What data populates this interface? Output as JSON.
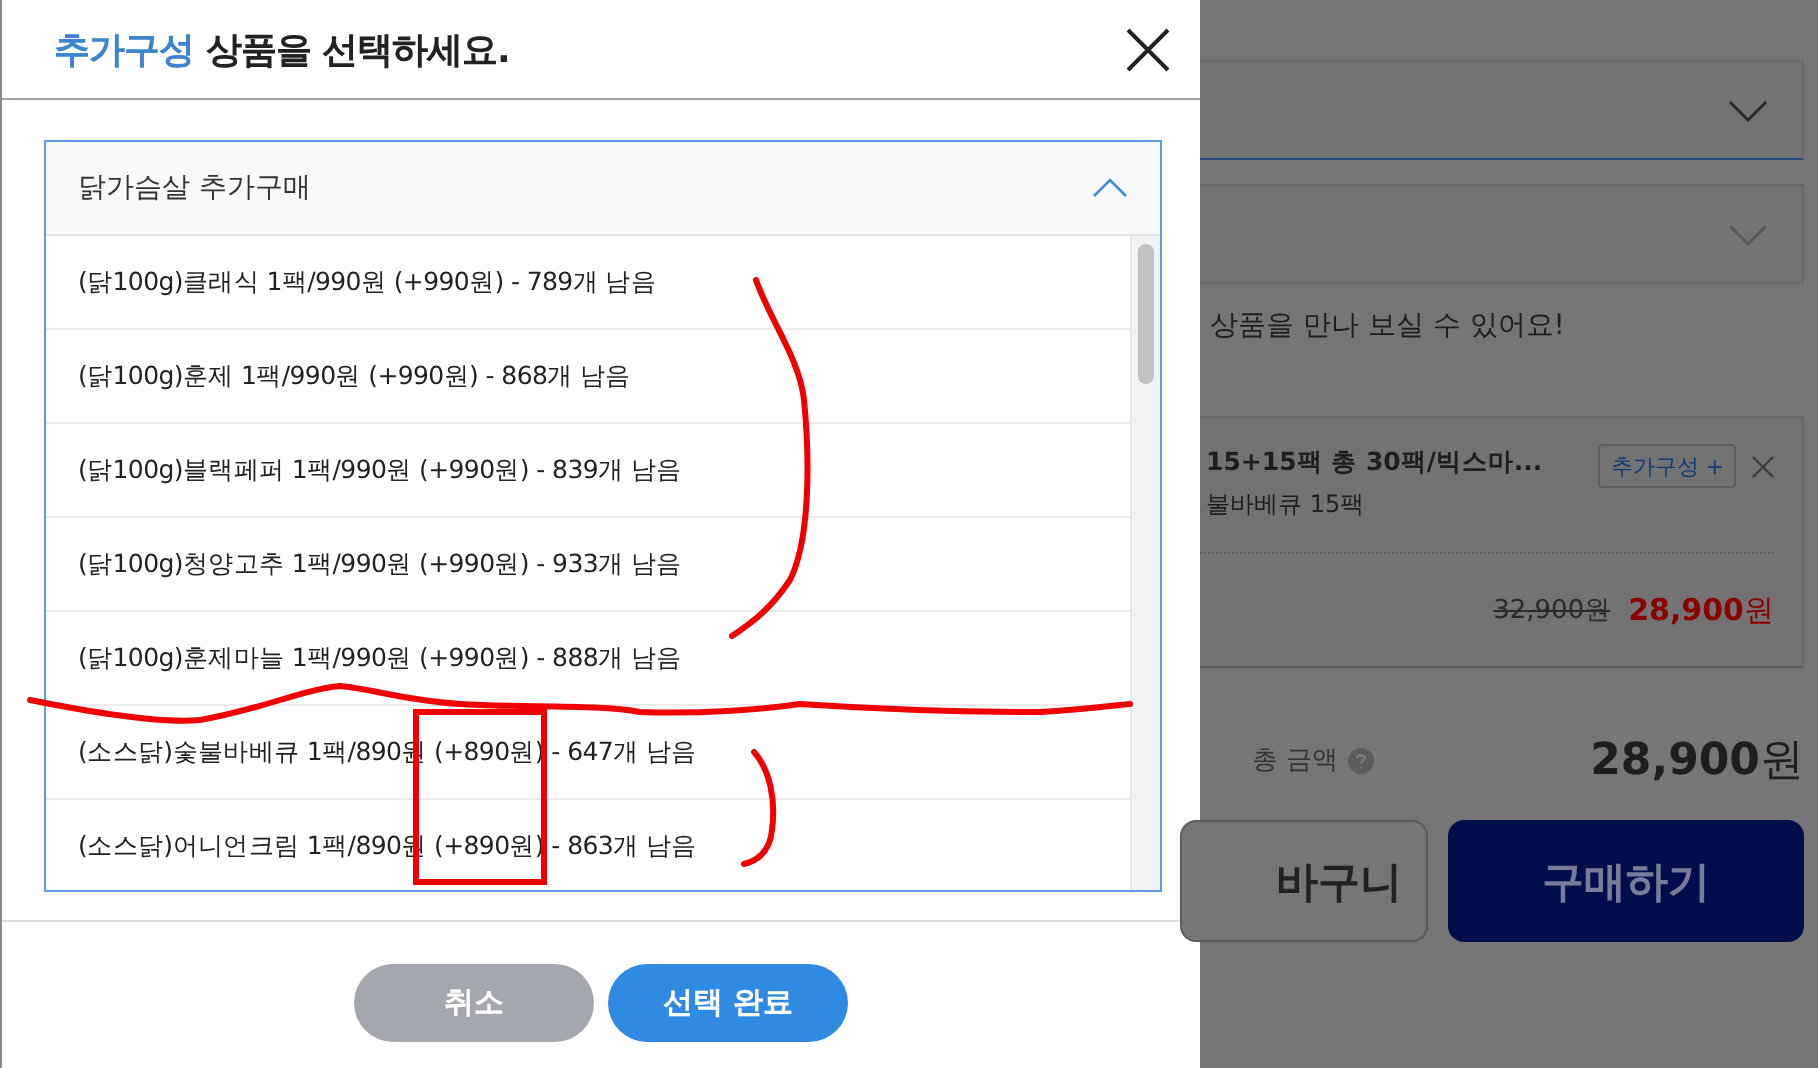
{
  "modal": {
    "title_highlight": "추가구성",
    "title_rest": "상품을 선택하세요.",
    "accordion": {
      "title": "닭가슴살 추가구매",
      "expanded": true,
      "options": [
        {
          "label": "(닭100g)클래식 1팩/990원 (+990원) - 789개 남음"
        },
        {
          "label": "(닭100g)훈제 1팩/990원 (+990원) - 868개 남음"
        },
        {
          "label": "(닭100g)블랙페퍼 1팩/990원 (+990원) - 839개 남음"
        },
        {
          "label": "(닭100g)청양고추 1팩/990원 (+990원) - 933개 남음"
        },
        {
          "label": "(닭100g)훈제마늘 1팩/990원 (+990원) - 888개 남음"
        },
        {
          "label": "(소스닭)숯불바베큐 1팩/890원 (+890원) - 647개 남음"
        },
        {
          "label": "(소스닭)어니언크림 1팩/890원 (+890원) - 863개 남음"
        }
      ]
    },
    "buttons": [
      {
        "label": "취소",
        "kind": "cancel"
      },
      {
        "label": "선택 완료",
        "kind": "confirm"
      }
    ]
  },
  "page": {
    "dropdowns": [
      {
        "disabled": false
      },
      {
        "disabled": true
      }
    ],
    "notice": "상품을 만나 보실 수 있어요!",
    "cart_item": {
      "title": "15+15팩 총 30팩/빅스마...",
      "subtitle": "불바베큐 15팩",
      "tag": "추가구성 +",
      "original_price": "32,900원",
      "price": "**28,900**원"
    },
    "total_label": "총 금액",
    "total": "**28,900**원",
    "buttons": [
      {
        "label": "바구니",
        "kind": "cart"
      },
      {
        "label": "구매하기",
        "kind": "buy"
      }
    ]
  }
}
